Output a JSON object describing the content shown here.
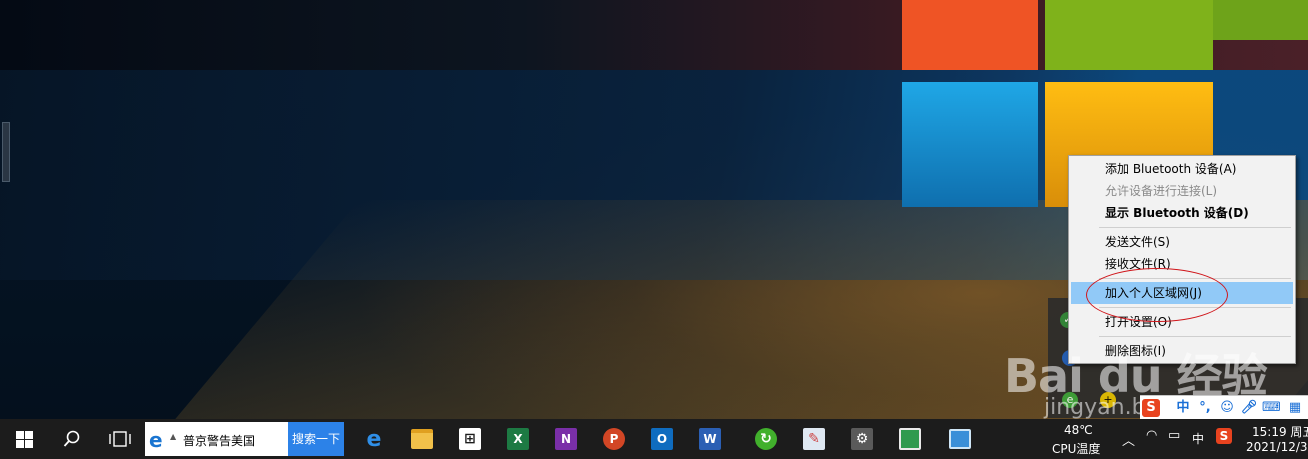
{
  "context_menu": {
    "items": [
      {
        "label": "添加 Bluetooth 设备(A)"
      },
      {
        "label": "允许设备进行连接(L)"
      },
      {
        "label": "显示 Bluetooth 设备(D)"
      },
      {
        "label": "发送文件(S)"
      },
      {
        "label": "接收文件(R)"
      },
      {
        "label": "加入个人区域网(J)"
      },
      {
        "label": "打开设置(O)"
      },
      {
        "label": "删除图标(I)"
      }
    ]
  },
  "taskbar": {
    "search_text": "普京警告美国",
    "search_button": "搜索一下",
    "temperature": "48℃",
    "temperature_label": "CPU温度",
    "ime_mode": "中",
    "time": "15:19 周五",
    "date": "2021/12/3",
    "pinned": [
      {
        "icon": "edge-icon"
      },
      {
        "icon": "file-explorer-icon"
      },
      {
        "icon": "store-icon"
      },
      {
        "icon": "excel-icon"
      },
      {
        "icon": "onenote-icon"
      },
      {
        "icon": "powerpoint-icon"
      },
      {
        "icon": "outlook-icon"
      },
      {
        "icon": "word-icon"
      },
      {
        "icon": "green-refresh-icon"
      },
      {
        "icon": "paint-icon"
      },
      {
        "icon": "settings-icon"
      },
      {
        "icon": "image-app-icon"
      },
      {
        "icon": "screen-app-icon"
      }
    ]
  },
  "ime_bar": {
    "mode": "中"
  },
  "watermark": {
    "brand": "Bai du 经验",
    "domain": "jingyan.baidu.com"
  },
  "colors": {
    "menu_highlight": "#91c9f7",
    "annotation_red": "#d0161b",
    "search_button": "#2c82e8",
    "taskbar": "#1c1c1c"
  }
}
